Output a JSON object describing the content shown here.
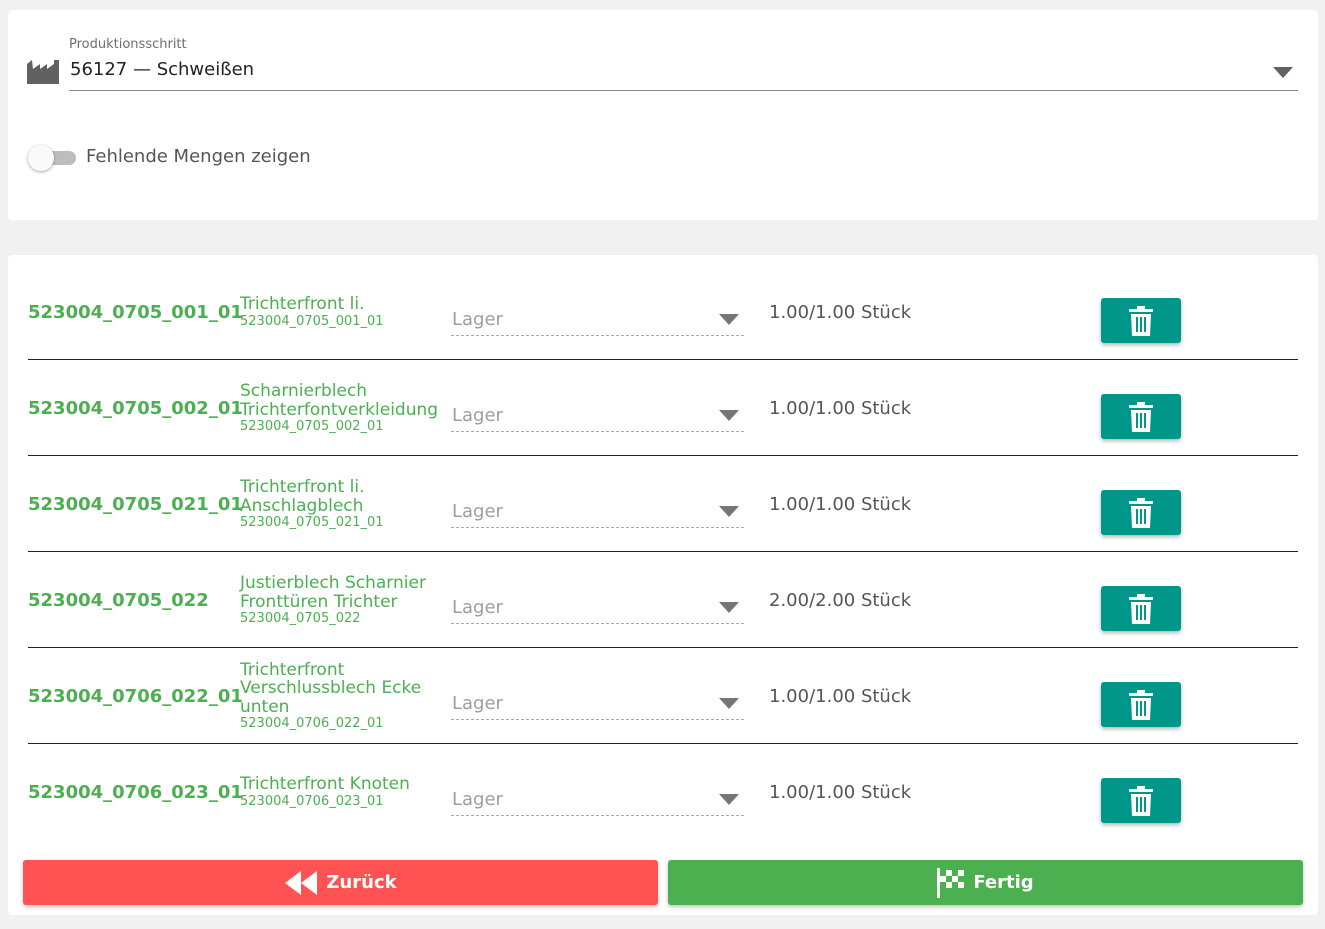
{
  "step": {
    "label": "Produktionsschritt",
    "value": "56127 — Schweißen",
    "icon": "factory-icon"
  },
  "toggle": {
    "label": "Fehlende Mengen zeigen",
    "checked": false
  },
  "rows": [
    {
      "code": "523004_0705_001_01",
      "name": "Trichterfront li.",
      "sub": "523004_0705_001_01",
      "lager_placeholder": "Lager",
      "qty": "1.00/1.00 Stück"
    },
    {
      "code": "523004_0705_002_01",
      "name": "Scharnierblech Trichterfontverkleidung",
      "sub": "523004_0705_002_01",
      "lager_placeholder": "Lager",
      "qty": "1.00/1.00 Stück"
    },
    {
      "code": "523004_0705_021_01",
      "name": "Trichterfront li. Anschlagblech",
      "sub": "523004_0705_021_01",
      "lager_placeholder": "Lager",
      "qty": "1.00/1.00 Stück"
    },
    {
      "code": "523004_0705_022",
      "name": "Justierblech Scharnier Fronttüren Trichter",
      "sub": "523004_0705_022",
      "lager_placeholder": "Lager",
      "qty": "2.00/2.00 Stück"
    },
    {
      "code": "523004_0706_022_01",
      "name": "Trichterfront Verschlussblech Ecke unten",
      "sub": "523004_0706_022_01",
      "lager_placeholder": "Lager",
      "qty": "1.00/1.00 Stück"
    },
    {
      "code": "523004_0706_023_01",
      "name": "Trichterfront Knoten",
      "sub": "523004_0706_023_01",
      "lager_placeholder": "Lager",
      "qty": "1.00/1.00 Stück"
    }
  ],
  "buttons": {
    "back": "Zurück",
    "done": "Fertig"
  },
  "colors": {
    "accent_green": "#4caf50",
    "teal": "#00968a",
    "red": "#ff5252"
  }
}
